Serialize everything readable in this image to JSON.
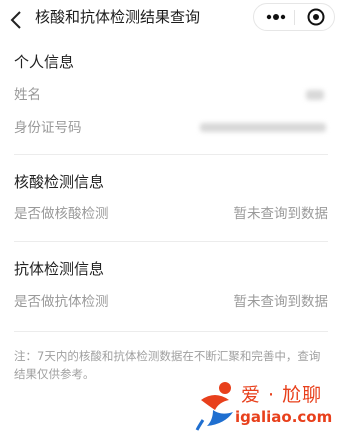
{
  "header": {
    "title": "核酸和抗体检测结果查询",
    "back_icon": "chevron-left-icon",
    "more_icon": "more-dots-icon",
    "close_icon": "target-circle-icon"
  },
  "personal": {
    "title": "个人信息",
    "name_label": "姓名",
    "id_label": "身份证号码"
  },
  "nucleic": {
    "title": "核酸检测信息",
    "row_label": "是否做核酸检测",
    "row_value": "暂未查询到数据"
  },
  "antibody": {
    "title": "抗体检测信息",
    "row_label": "是否做抗体检测",
    "row_value": "暂未查询到数据"
  },
  "note": {
    "line1": "注：7天内的核酸和抗体检测数据在不断汇聚和完善中，查询",
    "line2": "结果仅供参考。"
  },
  "watermark": {
    "top_text": "爱 · 尬聊",
    "url": "igaliao.com",
    "accent": "#e8401c",
    "accent2": "#1f6fd0"
  }
}
